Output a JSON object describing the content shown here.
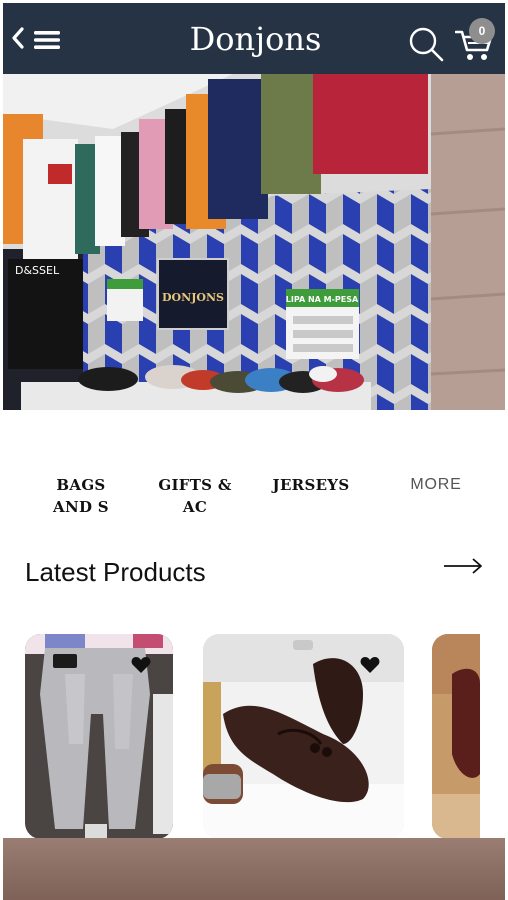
{
  "header": {
    "title": "Donjons",
    "cart_count": "0",
    "icons": [
      "back-icon",
      "menu-icon",
      "search-icon",
      "cart-icon"
    ]
  },
  "hero": {
    "alt": "Donjons store interior with shirts and sneakers on display",
    "store_sign": "DONJONS",
    "mpesa_sign": "LIPA NA M-PESA"
  },
  "categories": [
    {
      "label": "BAGS\nAND S"
    },
    {
      "label": "GIFTS &\nAC"
    },
    {
      "label": "JERSEYS"
    },
    {
      "label": "MORE"
    }
  ],
  "latest": {
    "title": "Latest Products",
    "arrow_icon": "arrow-right-icon"
  },
  "products": [
    {
      "name": "grey jeans",
      "icon": "heart-icon"
    },
    {
      "name": "brown loafers",
      "icon": "heart-icon"
    },
    {
      "name": "brown leather shoe",
      "icon": "heart-icon"
    }
  ],
  "colors": {
    "header_bg": "#263345",
    "badge_bg": "#8e8e8e",
    "text": "#111111"
  }
}
